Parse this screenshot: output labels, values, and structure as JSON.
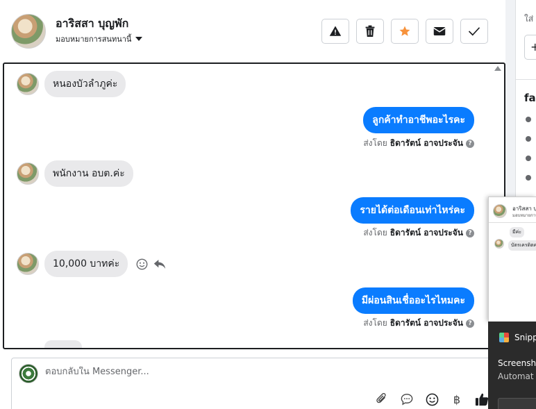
{
  "header": {
    "contact_name": "อาริสสา บุญพัก",
    "assign_label": "มอบหมายการสนทนานี้"
  },
  "messages": [
    {
      "direction": "in",
      "text": "หนองบัวลำภูค่ะ"
    },
    {
      "direction": "out",
      "text": "ลูกค้าทำอาชีพอะไรคะ",
      "sent_prefix": "ส่งโดย",
      "agent": "ธิดารัตน์ อาจประจัน"
    },
    {
      "direction": "in",
      "text": "พนักงาน อบต.ค่ะ"
    },
    {
      "direction": "out",
      "text": "รายได้ต่อเดือนเท่าไหร่คะ",
      "sent_prefix": "ส่งโดย",
      "agent": "ธิดารัตน์ อาจประจัน"
    },
    {
      "direction": "in",
      "text": "10,000 บาทค่ะ"
    },
    {
      "direction": "out",
      "text": "มีผ่อนสินเชื่ออะไรไหมคะ",
      "sent_prefix": "ส่งโดย",
      "agent": "ธิดารัตน์ อาจประจัน"
    }
  ],
  "help_glyph": "?",
  "composer": {
    "placeholder": "ตอบกลับใน Messenger...",
    "baht_glyph": "฿"
  },
  "sidebar": {
    "partial_text": "ใส่",
    "add_glyph": "+",
    "section_title": "fac"
  },
  "preview": {
    "name": "อาริสสา บุ",
    "assign": "มอบหมายการ",
    "bubble1": "มีค่ะ",
    "bubble2": "บัตรเครดิตค"
  },
  "toast": {
    "app": "Snipp",
    "title": "Screensh",
    "body": "Automat"
  },
  "colors": {
    "accent_blue": "#0a7cff",
    "star_orange": "#f7923b",
    "incoming_bubble": "#e9e9eb"
  }
}
